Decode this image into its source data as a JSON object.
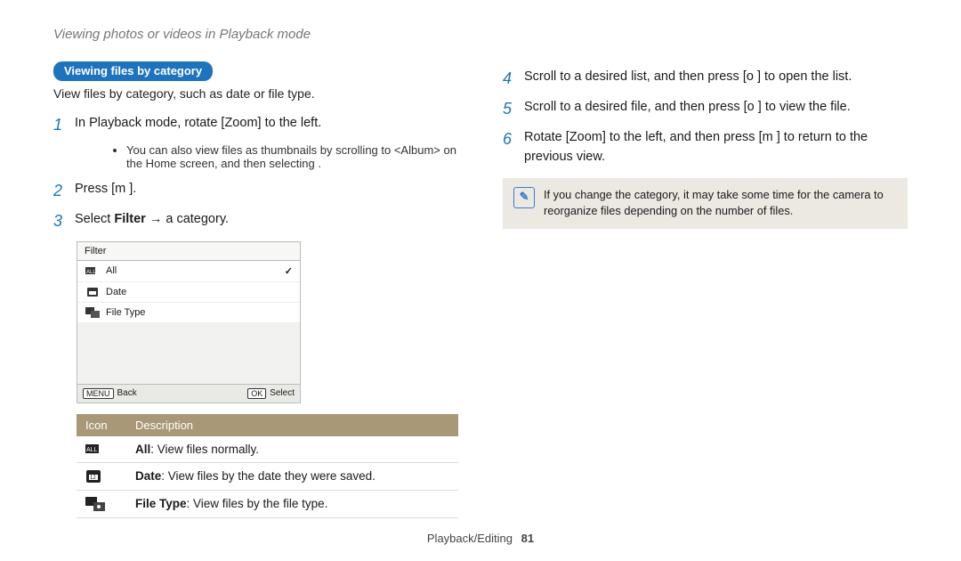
{
  "section_title": "Viewing photos or videos in Playback mode",
  "left": {
    "badge": "Viewing files by category",
    "intro": "View files by category, such as date or file type.",
    "steps": {
      "s1": {
        "n": "1",
        "pre": "In Playback mode, rotate [",
        "key": "Zoom",
        "post": "] to the left."
      },
      "s1_sub": "You can also view files as thumbnails by scrolling to <Album> on the Home screen, and then selecting     .",
      "s2": {
        "n": "2",
        "pre": "Press [",
        "key": "m",
        "post": "      ]."
      },
      "s3": {
        "n": "3",
        "pre": "Select ",
        "key": "Filter",
        "mid": " → ",
        "post": "a category."
      }
    },
    "filter": {
      "title": "Filter",
      "rows": [
        {
          "label": "All",
          "selected": true
        },
        {
          "label": "Date",
          "selected": false
        },
        {
          "label": "File Type",
          "selected": false
        }
      ],
      "foot_back_tag": "MENU",
      "foot_back": "Back",
      "foot_sel_tag": "OK",
      "foot_sel": "Select"
    },
    "table": {
      "h_icon": "Icon",
      "h_desc": "Description",
      "rows": [
        {
          "name": "All",
          "desc": ": View files normally."
        },
        {
          "name": "Date",
          "desc": ": View files by the date they were saved."
        },
        {
          "name": "File Type",
          "desc": ": View files by the file type."
        }
      ]
    }
  },
  "right": {
    "s4": {
      "n": "4",
      "pre": "Scroll to a desired list, and then press [",
      "key": "o",
      "post": "     ] to open the list."
    },
    "s5": {
      "n": "5",
      "pre": "Scroll to a desired file, and then press [",
      "key": "o",
      "post": "     ] to view the file."
    },
    "s6": {
      "n": "6",
      "pre": "Rotate [",
      "key": "Zoom",
      "mid": "] to the left, and then press [",
      "key2": "m",
      "post": "       ] to return to the previous view."
    },
    "note": "If you change the category, it may take some time for the camera to reorganize files depending on the number of files."
  },
  "footer": {
    "section": "Playback/Editing",
    "page": "81"
  }
}
